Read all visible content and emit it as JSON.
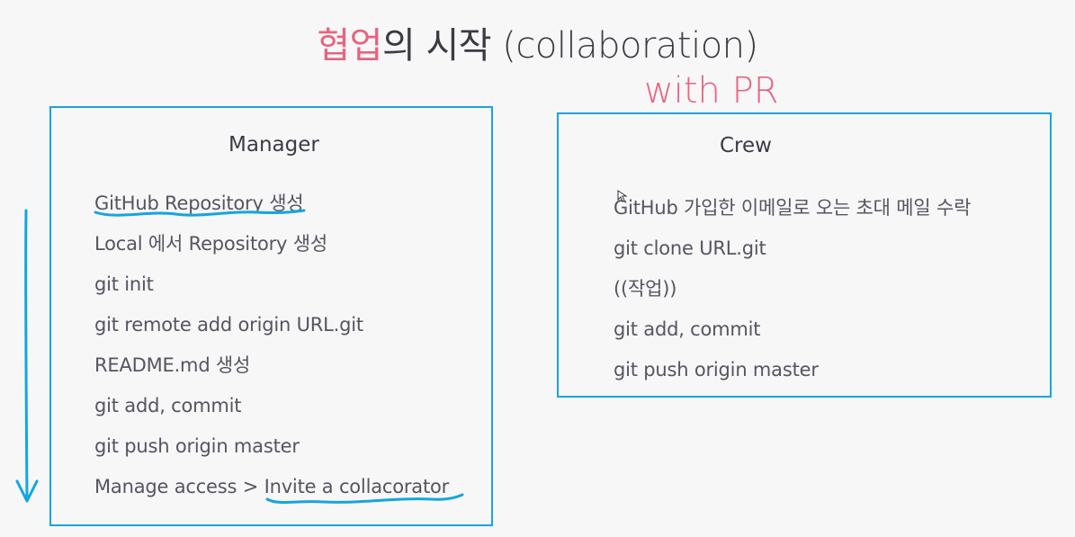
{
  "title": {
    "accent": "협업",
    "rest": "의 시작 (collaboration)",
    "subtitle": "with PR"
  },
  "manager": {
    "heading": "Manager",
    "steps": [
      "GitHub Repository 생성",
      "Local 에서 Repository 생성",
      "git init",
      "git remote add origin URL.git",
      "README.md 생성",
      "git add, commit",
      "git push origin master",
      "Manage access > Invite a collacorator"
    ]
  },
  "crew": {
    "heading": "Crew",
    "steps": [
      "GitHub 가입한 이메일로 오는 초대 메일 수락",
      "git clone URL.git",
      "((작업))",
      "git add, commit",
      "git push origin master"
    ]
  },
  "colors": {
    "accent": "#e8637f",
    "box_border": "#1aa3df",
    "annotation": "#12a6e0"
  }
}
